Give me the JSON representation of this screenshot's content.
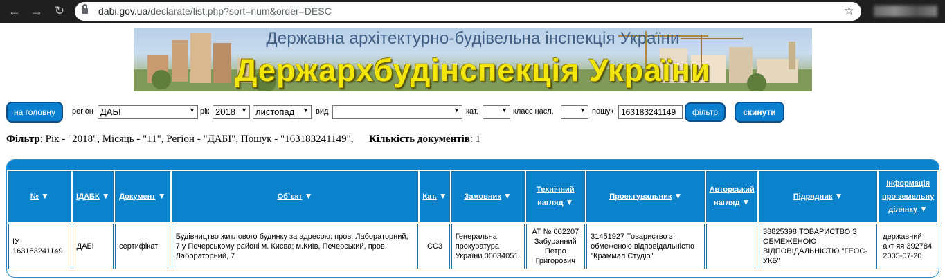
{
  "browser": {
    "back_icon": "arrow-left-icon",
    "forward_icon": "arrow-right-icon",
    "reload_icon": "reload-icon",
    "url_host": "dabi.gov.ua",
    "url_path": "/declarate/list.php?sort=num&order=DESC"
  },
  "banner": {
    "subtitle": "Державна архітектурно-будівельна інспекція України",
    "title": "Держархбудінспекція України"
  },
  "filters": {
    "home_button": "на головну",
    "region_label": "регіон",
    "region_value": "ДАБІ",
    "year_label": "рік",
    "year_value": "2018",
    "month_value": "листопад",
    "kind_label": "вид",
    "kind_value": "",
    "cat_label": "кат.",
    "cat_value": "",
    "class_label": "класс насл.",
    "class_value": "",
    "search_label": "пошук",
    "search_value": "163183241149",
    "filter_button": "фільтр",
    "reset_button": "скинути"
  },
  "summary": {
    "filter_label": "Фільтр",
    "filter_text": ": Рік - \"2018\", Місяць - \"11\", Регіон - \"ДАБІ\", Пошук - \"163183241149\",",
    "count_label": "Кількість документів",
    "count_value": ": 1"
  },
  "table": {
    "headers": [
      "№",
      "ІДАБК",
      "Документ",
      "Об`єкт",
      "Кат.",
      "Замовник",
      "Технічний нагляд",
      "Проектувальник",
      "Авторський нагляд",
      "Підрядник",
      "Інформація про земельну ділянку"
    ],
    "rows": [
      [
        "ІУ 163183241149",
        "ДАБІ",
        "сертифікат",
        "Будівництво житлового будинку за адресою: пров. Лабораторний, 7 у Печерському районі м. Києва; м.Київ, Печерський, пров. Лабораторний, 7",
        "СС3",
        "Генеральна прокуратура України 00034051",
        "АТ № 002207 Забуранний Петро Григорович",
        "31451927 Товариство з обмеженою відповідальністю \"Краммал Студіо\"",
        "",
        "38825398 ТОВАРИСТВО З ОБМЕЖЕНОЮ ВІДПОВІДАЛЬНІСТЮ \"ГЕОС-УКБ\"",
        "державний акт яя 392784 2005-07-20"
      ]
    ]
  }
}
